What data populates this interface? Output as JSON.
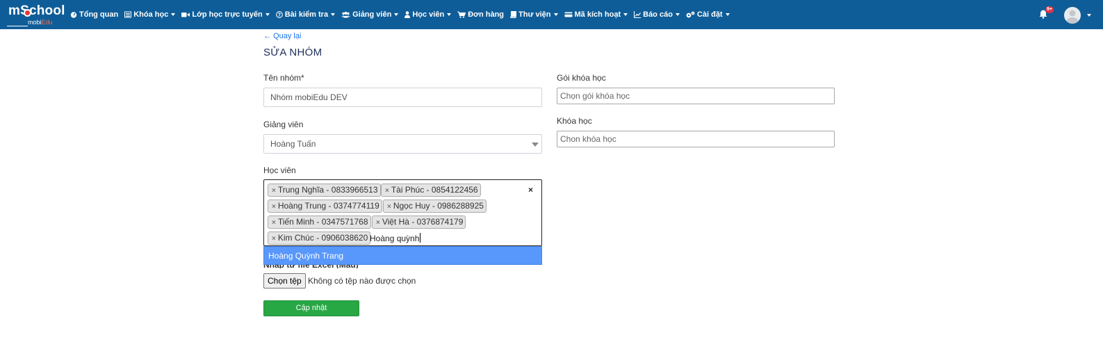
{
  "brand": {
    "main": "mSchool",
    "sub_prefix": "mobi",
    "sub_suffix": "Edu"
  },
  "nav": {
    "items": [
      {
        "label": "Tổng quan",
        "icon": "dashboard-icon",
        "caret": false
      },
      {
        "label": "Khóa học",
        "icon": "list-icon",
        "caret": true
      },
      {
        "label": "Lớp học trực tuyến",
        "icon": "video-icon",
        "caret": true
      },
      {
        "label": "Bài kiểm tra",
        "icon": "question-circle-icon",
        "caret": true
      },
      {
        "label": "Giảng viên",
        "icon": "users-icon",
        "caret": true
      },
      {
        "label": "Học viên",
        "icon": "user-icon",
        "caret": true
      },
      {
        "label": "Đơn hàng",
        "icon": "cart-icon",
        "caret": false
      },
      {
        "label": "Thư viện",
        "icon": "book-icon",
        "caret": true
      },
      {
        "label": "Mã kích hoạt",
        "icon": "key-card-icon",
        "caret": true
      },
      {
        "label": "Báo cáo",
        "icon": "chart-icon",
        "caret": true
      },
      {
        "label": "Cài đặt",
        "icon": "gears-icon",
        "caret": true
      }
    ],
    "notification_badge": "9+"
  },
  "page": {
    "back_label": "Quay lại",
    "title": "SỬA NHÓM"
  },
  "form": {
    "group_name": {
      "label": "Tên nhóm*",
      "value": "Nhóm mobiEdu DEV"
    },
    "teacher": {
      "label": "Giảng viên",
      "value": "Hoàng Tuấn"
    },
    "students": {
      "label": "Học viên",
      "tags": [
        "Trung Nghĩa - 0833966513",
        "Tài Phúc - 0854122456",
        "Hoàng Trung - 0374774119",
        "Ngọc Huy - 0986288925",
        "Tiến Minh - 0347571768",
        "Việt Hà - 0376874179",
        "Kim Chúc - 0906038620"
      ],
      "search_text": "Hoàng quỳnh",
      "clear_symbol": "×",
      "suggestion": "Hoàng Quỳnh Trang"
    },
    "course_package": {
      "label": "Gói khóa học",
      "placeholder": "Chọn gói khóa học"
    },
    "course": {
      "label": "Khóa học",
      "placeholder": "Chon khóa học"
    },
    "excel_import": {
      "label": "Nhập từ file Excel (Mẫu)",
      "button_label": "Chọn tệp",
      "status": "Không có tệp nào được chọn"
    },
    "submit_label": "Cập nhật"
  }
}
